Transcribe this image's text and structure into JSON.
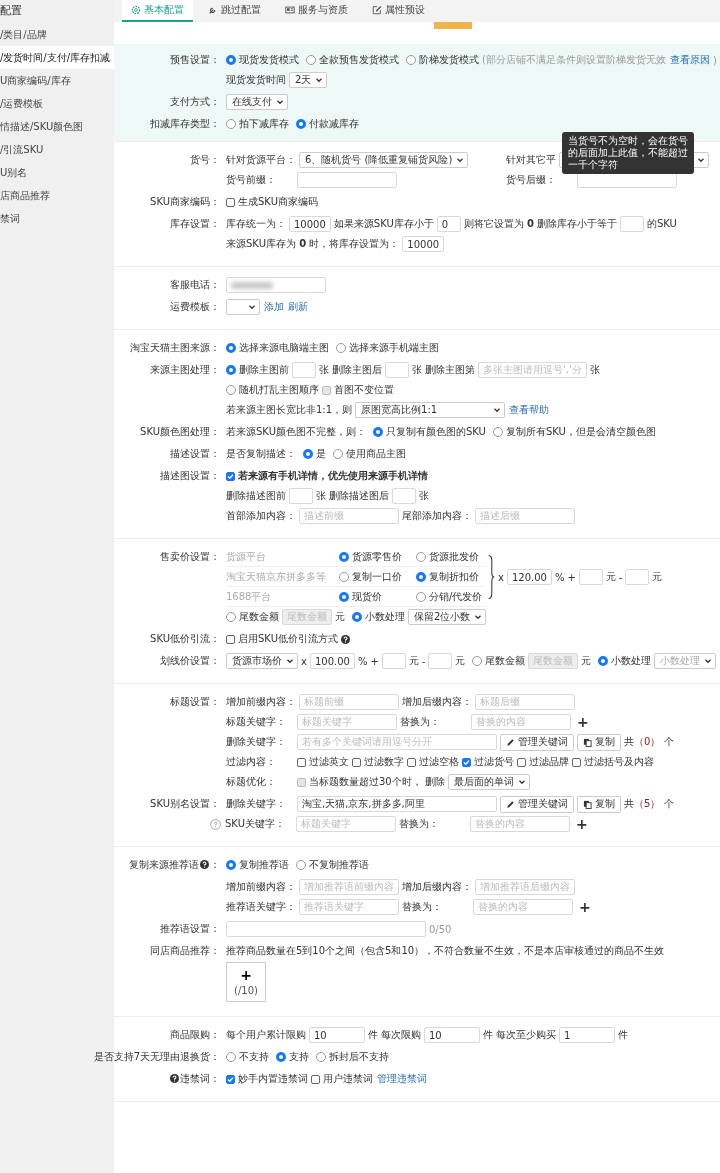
{
  "sidebar": {
    "title": "配置",
    "items": [
      {
        "label": "/类目/品牌",
        "selected": false
      },
      {
        "label": "/发货时间/支付/库存扣减",
        "selected": true
      },
      {
        "label": "U商家编码/库存",
        "selected": false
      },
      {
        "label": "/运费模板",
        "selected": false
      },
      {
        "label": "情描述/SKU颜色图",
        "selected": false
      },
      {
        "label": "/引流SKU",
        "selected": false
      },
      {
        "label": "U别名",
        "selected": false
      },
      {
        "label": "店商品推荐",
        "selected": false
      },
      {
        "label": "禁词",
        "selected": false
      }
    ]
  },
  "tabs": [
    {
      "label": "基本配置",
      "selected": true
    },
    {
      "label": "跳过配置",
      "selected": false
    },
    {
      "label": "服务与资质",
      "selected": false
    },
    {
      "label": "属性预设",
      "selected": false
    }
  ],
  "sections": [
    {
      "tinted": true,
      "rows": [
        {
          "label": "预售设置：",
          "lines": [
            [
              {
                "kind": "radio",
                "label": "现货发货模式",
                "selected": true
              },
              {
                "kind": "radio",
                "label": "全款预售发货模式",
                "selected": false
              },
              {
                "kind": "radio",
                "label": "阶梯发货模式",
                "selected": false
              },
              {
                "kind": "text",
                "text": "(部分店铺不满足条件则设置阶梯发货无效",
                "muted": true
              },
              {
                "kind": "link",
                "text": "查看原因"
              },
              {
                "kind": "text",
                "text": ")",
                "muted": true
              }
            ],
            [
              {
                "kind": "text",
                "text": "现货发货时间"
              },
              {
                "kind": "select",
                "value": "2天"
              }
            ]
          ]
        },
        {
          "label": "支付方式：",
          "lines": [
            [
              {
                "kind": "select",
                "value": "在线支付"
              }
            ]
          ]
        },
        {
          "label": "扣减库存类型：",
          "lines": [
            [
              {
                "kind": "radio",
                "label": "拍下减库存",
                "selected": false
              },
              {
                "kind": "radio",
                "label": "付款减库存",
                "selected": true
              }
            ]
          ]
        }
      ]
    },
    {
      "tinted": false,
      "rows": [
        {
          "label": "货号：",
          "lines": [
            [
              {
                "kind": "text",
                "text": "针对货源平台："
              },
              {
                "kind": "wide-select",
                "value": "6、随机货号 (降低重复铺货风险)"
              }
            ],
            [
              {
                "kind": "caption",
                "text": "货号前缀："
              },
              {
                "kind": "input"
              }
            ]
          ],
          "aside_lines": [
            [
              {
                "kind": "text",
                "text": "针对其它平"
              },
              {
                "kind": "wide-select"
              }
            ],
            [
              {
                "kind": "caption",
                "text": "货号后缀："
              },
              {
                "kind": "input"
              }
            ]
          ],
          "tooltip": "当货号不为空时，会在货号的后面加上此值，不能超过一千个字符"
        },
        {
          "label": "SKU商家编码：",
          "lines": [
            [
              {
                "kind": "checkbox",
                "label": "生成SKU商家编码",
                "checked": false
              }
            ]
          ]
        },
        {
          "label": "库存设置：",
          "lines": [
            [
              {
                "kind": "text",
                "text": "库存统一为："
              },
              {
                "kind": "number-input",
                "value": "10000"
              },
              {
                "kind": "text",
                "text": "如果来源SKU库存小于"
              },
              {
                "kind": "number-input",
                "value": "0"
              },
              {
                "kind": "text",
                "text": "则将它设置为 **0**"
              },
              {
                "kind": "text",
                "text": "删除库存小于等于"
              },
              {
                "kind": "number-input"
              },
              {
                "kind": "text",
                "text": "的SKU"
              }
            ],
            [
              {
                "kind": "text",
                "text": "来源SKU库存为 **0** 时，将库存设置为："
              },
              {
                "kind": "number-input",
                "value": "10000"
              }
            ]
          ]
        }
      ]
    },
    {
      "tinted": false,
      "rows": [
        {
          "label": "客服电话：",
          "lines": [
            [
              {
                "kind": "redacted-input"
              }
            ]
          ]
        },
        {
          "label": "运费模板：",
          "lines": [
            [
              {
                "kind": "select"
              },
              {
                "kind": "link",
                "text": "添加"
              },
              {
                "kind": "link",
                "text": "刷新"
              }
            ]
          ]
        }
      ]
    },
    {
      "tinted": false,
      "rows": [
        {
          "label": "淘宝天猫主图来源：",
          "lines": [
            [
              {
                "kind": "radio",
                "label": "选择来源电脑端主图",
                "selected": true
              },
              {
                "kind": "radio",
                "label": "选择来源手机端主图",
                "selected": false
              }
            ]
          ]
        },
        {
          "label": "来源主图处理：",
          "lines": [
            [
              {
                "kind": "radio",
                "label": "删除主图前",
                "selected": true
              },
              {
                "kind": "number-input"
              },
              {
                "kind": "text",
                "text": "张"
              },
              {
                "kind": "text",
                "text": "删除主图后"
              },
              {
                "kind": "number-input"
              },
              {
                "kind": "text",
                "text": "张"
              },
              {
                "kind": "text",
                "text": "删除主图第"
              },
              {
                "kind": "input",
                "placeholder": "多张主图请用逗号','分"
              },
              {
                "kind": "text",
                "text": "张"
              }
            ],
            [
              {
                "kind": "radio",
                "label": "随机打乱主图顺序",
                "selected": false
              },
              {
                "kind": "checkbox",
                "label": "首图不变位置",
                "checked": false,
                "disabled": true
              }
            ],
            [
              {
                "kind": "text",
                "text": "若来源主图长宽比非1:1，则"
              },
              {
                "kind": "wide-select",
                "value": "原图宽高比例1:1"
              },
              {
                "kind": "link",
                "text": "查看帮助"
              }
            ]
          ]
        },
        {
          "label": "SKU颜色图处理：",
          "lines": [
            [
              {
                "kind": "text",
                "text": "若来源SKU颜色图不完整，则："
              },
              {
                "kind": "radio",
                "label": "只复制有颜色图的SKU",
                "selected": true
              },
              {
                "kind": "radio",
                "label": "复制所有SKU，但是会清空颜色图",
                "selected": false
              }
            ]
          ]
        },
        {
          "label": "描述设置：",
          "lines": [
            [
              {
                "kind": "text",
                "text": "是否复制描述："
              },
              {
                "kind": "radio",
                "label": "是",
                "selected": true
              },
              {
                "kind": "radio",
                "label": "使用商品主图",
                "selected": false
              }
            ]
          ]
        },
        {
          "label": "描述图设置：",
          "lines": [
            [
              {
                "kind": "checkbox",
                "label": "若来源有手机详情，优先使用来源手机详情",
                "checked": true,
                "bold": true
              }
            ],
            [
              {
                "kind": "text",
                "text": "删除描述图前"
              },
              {
                "kind": "number-input"
              },
              {
                "kind": "text",
                "text": "张"
              },
              {
                "kind": "text",
                "text": "删除描述图后"
              },
              {
                "kind": "number-input"
              },
              {
                "kind": "text",
                "text": "张"
              }
            ],
            [
              {
                "kind": "caption",
                "text": "首部添加内容："
              },
              {
                "kind": "input",
                "placeholder": "描述前缀"
              },
              {
                "kind": "caption",
                "text": "尾部添加内容："
              },
              {
                "kind": "input",
                "placeholder": "描述后缀"
              }
            ]
          ]
        }
      ]
    },
    {
      "tinted": false,
      "rows": [
        {
          "label": "售卖价设置：",
          "kind": "price",
          "sources": [
            {
              "platform": "货源平台",
              "options": [
                {
                  "label": "货源零售价",
                  "selected": true
                },
                {
                  "label": "货源批发价",
                  "selected": false
                }
              ]
            },
            {
              "platform": "淘宝天猫京东拼多多等",
              "options": [
                {
                  "label": "复制一口价",
                  "selected": false
                },
                {
                  "label": "复制折扣价",
                  "selected": true
                }
              ]
            },
            {
              "platform": "1688平台",
              "options": [
                {
                  "label": "现货价",
                  "selected": true
                },
                {
                  "label": "分销/代发价",
                  "selected": false
                }
              ]
            }
          ],
          "formula": [
            {
              "kind": "text",
              "text": "x"
            },
            {
              "kind": "number-input",
              "value": "120.00"
            },
            {
              "kind": "text",
              "text": "%"
            },
            {
              "kind": "text",
              "text": "+"
            },
            {
              "kind": "number-input"
            },
            {
              "kind": "text",
              "text": "元"
            },
            {
              "kind": "text",
              "text": "-"
            },
            {
              "kind": "number-input"
            },
            {
              "kind": "text",
              "text": "元"
            }
          ],
          "lines": [
            [
              {
                "kind": "radio",
                "label": "尾数金额",
                "selected": false
              },
              {
                "kind": "number-input",
                "placeholder": "尾数金额",
                "disabled": true
              },
              {
                "kind": "text",
                "text": "元"
              },
              {
                "kind": "radio",
                "label": "小数处理",
                "selected": true
              },
              {
                "kind": "select",
                "value": "保留2位小数"
              }
            ]
          ]
        },
        {
          "label": "SKU低价引流：",
          "lines": [
            [
              {
                "kind": "checkbox",
                "label": "启用SKU低价引流方式",
                "checked": false
              },
              {
                "kind": "help"
              }
            ]
          ]
        },
        {
          "label": "划线价设置：",
          "lines": [
            [
              {
                "kind": "select",
                "value": "货源市场价"
              },
              {
                "kind": "text",
                "text": "x"
              },
              {
                "kind": "number-input",
                "value": "100.00"
              },
              {
                "kind": "text",
                "text": "%"
              },
              {
                "kind": "text",
                "text": "+"
              },
              {
                "kind": "number-input"
              },
              {
                "kind": "text",
                "text": "元"
              },
              {
                "kind": "text",
                "text": "-"
              },
              {
                "kind": "number-input"
              },
              {
                "kind": "text",
                "text": "元"
              },
              {
                "kind": "radio",
                "label": "尾数金额",
                "selected": false
              },
              {
                "kind": "number-input",
                "placeholder": "尾数金额",
                "disabled": true
              },
              {
                "kind": "text",
                "text": "元"
              },
              {
                "kind": "radio",
                "label": "小数处理",
                "selected": true
              },
              {
                "kind": "select",
                "placeholder": "小数处理"
              }
            ]
          ]
        }
      ]
    },
    {
      "tinted": false,
      "rows": [
        {
          "label": "标题设置：",
          "lines": [
            [
              {
                "kind": "caption",
                "text": "增加前缀内容："
              },
              {
                "kind": "input",
                "placeholder": "标题前缀"
              },
              {
                "kind": "caption",
                "text": "增加后缀内容："
              },
              {
                "kind": "input",
                "placeholder": "标题后缀"
              }
            ],
            [
              {
                "kind": "caption",
                "text": "标题关键字："
              },
              {
                "kind": "input",
                "placeholder": "标题关键字"
              },
              {
                "kind": "caption",
                "text": "替换为："
              },
              {
                "kind": "input",
                "placeholder": "替换的内容"
              },
              {
                "kind": "add",
                "text": "+"
              }
            ],
            [
              {
                "kind": "caption",
                "text": "删除关键字："
              },
              {
                "kind": "long-input",
                "placeholder": "若有多个关键词请用逗号分开"
              },
              {
                "kind": "edit-button",
                "text": "管理关键词"
              },
              {
                "kind": "copy-button",
                "text": "复制"
              },
              {
                "kind": "counter",
                "before": "共",
                "count": "（0）",
                "after": "个"
              }
            ],
            [
              {
                "kind": "caption",
                "text": "过滤内容："
              },
              {
                "kind": "checkbox",
                "label": "过滤英文",
                "checked": false
              },
              {
                "kind": "checkbox",
                "label": "过滤数字",
                "checked": false
              },
              {
                "kind": "checkbox",
                "label": "过滤空格",
                "checked": false
              },
              {
                "kind": "checkbox",
                "label": "过滤货号",
                "checked": true
              },
              {
                "kind": "checkbox",
                "label": "过滤品牌",
                "checked": false
              },
              {
                "kind": "checkbox",
                "label": "过滤括号及内容",
                "checked": false
              }
            ],
            [
              {
                "kind": "caption",
                "text": "标题优化："
              },
              {
                "kind": "checkbox",
                "label": "当标题数量超过30个时，",
                "checked": false,
                "disabled": true
              },
              {
                "kind": "text",
                "text": "删除"
              },
              {
                "kind": "select",
                "value": "最后面的单词"
              }
            ]
          ]
        },
        {
          "label": "SKU别名设置：",
          "lines": [
            [
              {
                "kind": "caption",
                "text": "删除关键字："
              },
              {
                "kind": "long-input",
                "value": "淘宝,天猫,京东,拼多多,阿里"
              },
              {
                "kind": "edit-button",
                "text": "管理关键词"
              },
              {
                "kind": "copy-button",
                "text": "复制"
              },
              {
                "kind": "counter",
                "before": "共",
                "count": "（5）",
                "after": "个"
              }
            ],
            [
              {
                "kind": "hint"
              },
              {
                "kind": "caption",
                "text": "SKU关键字："
              },
              {
                "kind": "input",
                "placeholder": "标题关键字"
              },
              {
                "kind": "caption",
                "text": "替换为："
              },
              {
                "kind": "input",
                "placeholder": "替换的内容"
              },
              {
                "kind": "add",
                "text": "+"
              }
            ]
          ]
        }
      ]
    },
    {
      "tinted": false,
      "rows": [
        {
          "label_parts": [
            {
              "kind": "text",
              "text": "复制来源推荐语"
            },
            {
              "kind": "help"
            },
            {
              "kind": "text",
              "text": "："
            }
          ],
          "lines": [
            [
              {
                "kind": "radio",
                "label": "复制推荐语",
                "selected": true
              },
              {
                "kind": "radio",
                "label": "不复制推荐语",
                "selected": false
              }
            ]
          ]
        },
        {
          "lines": [
            [
              {
                "kind": "caption",
                "text": "增加前缀内容："
              },
              {
                "kind": "input",
                "placeholder": "增加推荐语前缀内容"
              },
              {
                "kind": "caption",
                "text": "增加后缀内容："
              },
              {
                "kind": "input",
                "placeholder": "增加推荐语后缀内容"
              }
            ],
            [
              {
                "kind": "caption",
                "text": "推荐语关键字："
              },
              {
                "kind": "input",
                "placeholder": "推荐语关键字"
              },
              {
                "kind": "caption",
                "text": "替换为："
              },
              {
                "kind": "input",
                "placeholder": "替换的内容"
              },
              {
                "kind": "add",
                "text": "+"
              }
            ]
          ]
        },
        {
          "label": "推荐语设置：",
          "lines": [
            [
              {
                "kind": "long-input"
              },
              {
                "kind": "text",
                "text": "0/50",
                "muted": true
              }
            ]
          ]
        },
        {
          "label": "同店商品推荐：",
          "lines": [
            [
              {
                "kind": "text",
                "text": "推荐商品数量在5到10个之间（包含5和10），不符合数量不生效，不是本店审核通过的商品不生效"
              }
            ],
            [
              {
                "kind": "add-tile",
                "plus": "+",
                "count": "(/10)"
              }
            ]
          ]
        }
      ]
    },
    {
      "tinted": false,
      "rows": [
        {
          "label": "商品限购：",
          "lines": [
            [
              {
                "kind": "text",
                "text": "每个用户累计限购"
              },
              {
                "kind": "qty-input",
                "value": "10"
              },
              {
                "kind": "text",
                "text": "件"
              },
              {
                "kind": "text",
                "text": "每次限购"
              },
              {
                "kind": "qty-input",
                "value": "10"
              },
              {
                "kind": "text",
                "text": "件"
              },
              {
                "kind": "text",
                "text": "每次至少购买"
              },
              {
                "kind": "qty-input",
                "value": "1"
              },
              {
                "kind": "text",
                "text": "件"
              }
            ]
          ]
        },
        {
          "label": "是否支持7天无理由退换货：",
          "lines": [
            [
              {
                "kind": "radio",
                "label": "不支持",
                "selected": false
              },
              {
                "kind": "radio",
                "label": "支持",
                "selected": true
              },
              {
                "kind": "radio",
                "label": "拆封后不支持",
                "selected": false
              }
            ]
          ]
        },
        {
          "label_parts": [
            {
              "kind": "help"
            },
            {
              "kind": "text",
              "text": "违禁词："
            }
          ],
          "lines": [
            [
              {
                "kind": "checkbox",
                "label": "妙手内置违禁词",
                "checked": true
              },
              {
                "kind": "checkbox",
                "label": "用户违禁词",
                "checked": false
              },
              {
                "kind": "link",
                "text": "管理违禁词"
              }
            ]
          ]
        }
      ]
    }
  ]
}
